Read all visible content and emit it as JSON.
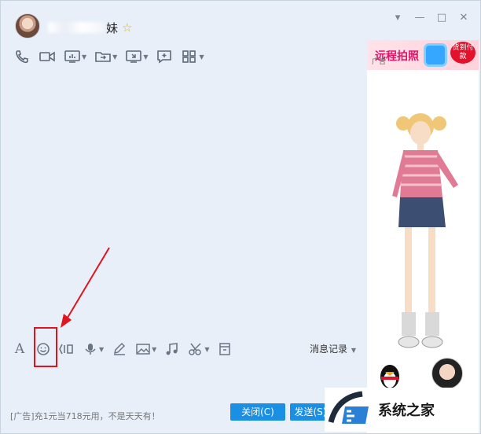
{
  "header": {
    "contact_name": "妹",
    "window_controls": [
      "▾",
      "—",
      "□",
      "✕"
    ]
  },
  "toolbar": {
    "items": [
      "phone-icon",
      "video-icon",
      "screen-share-icon",
      "file-transfer-icon",
      "remote-desktop-icon",
      "add-chat-icon",
      "apps-icon"
    ]
  },
  "ad_panel": {
    "banner_text": "远程拍照",
    "banner_tag": "广告",
    "badge_text": "货到付款"
  },
  "input_toolbar": {
    "font_label": "A",
    "history_label": "消息记录"
  },
  "footer": {
    "ad_text": "[广告]充1元当718元用，不是天天有！",
    "close_label": "关闭(C)",
    "send_label": "发送(S)"
  },
  "watermark": {
    "text": "系统之家"
  },
  "colors": {
    "accent": "#1a8fe3",
    "highlight": "#e0141e",
    "background": "#e8eff8"
  }
}
